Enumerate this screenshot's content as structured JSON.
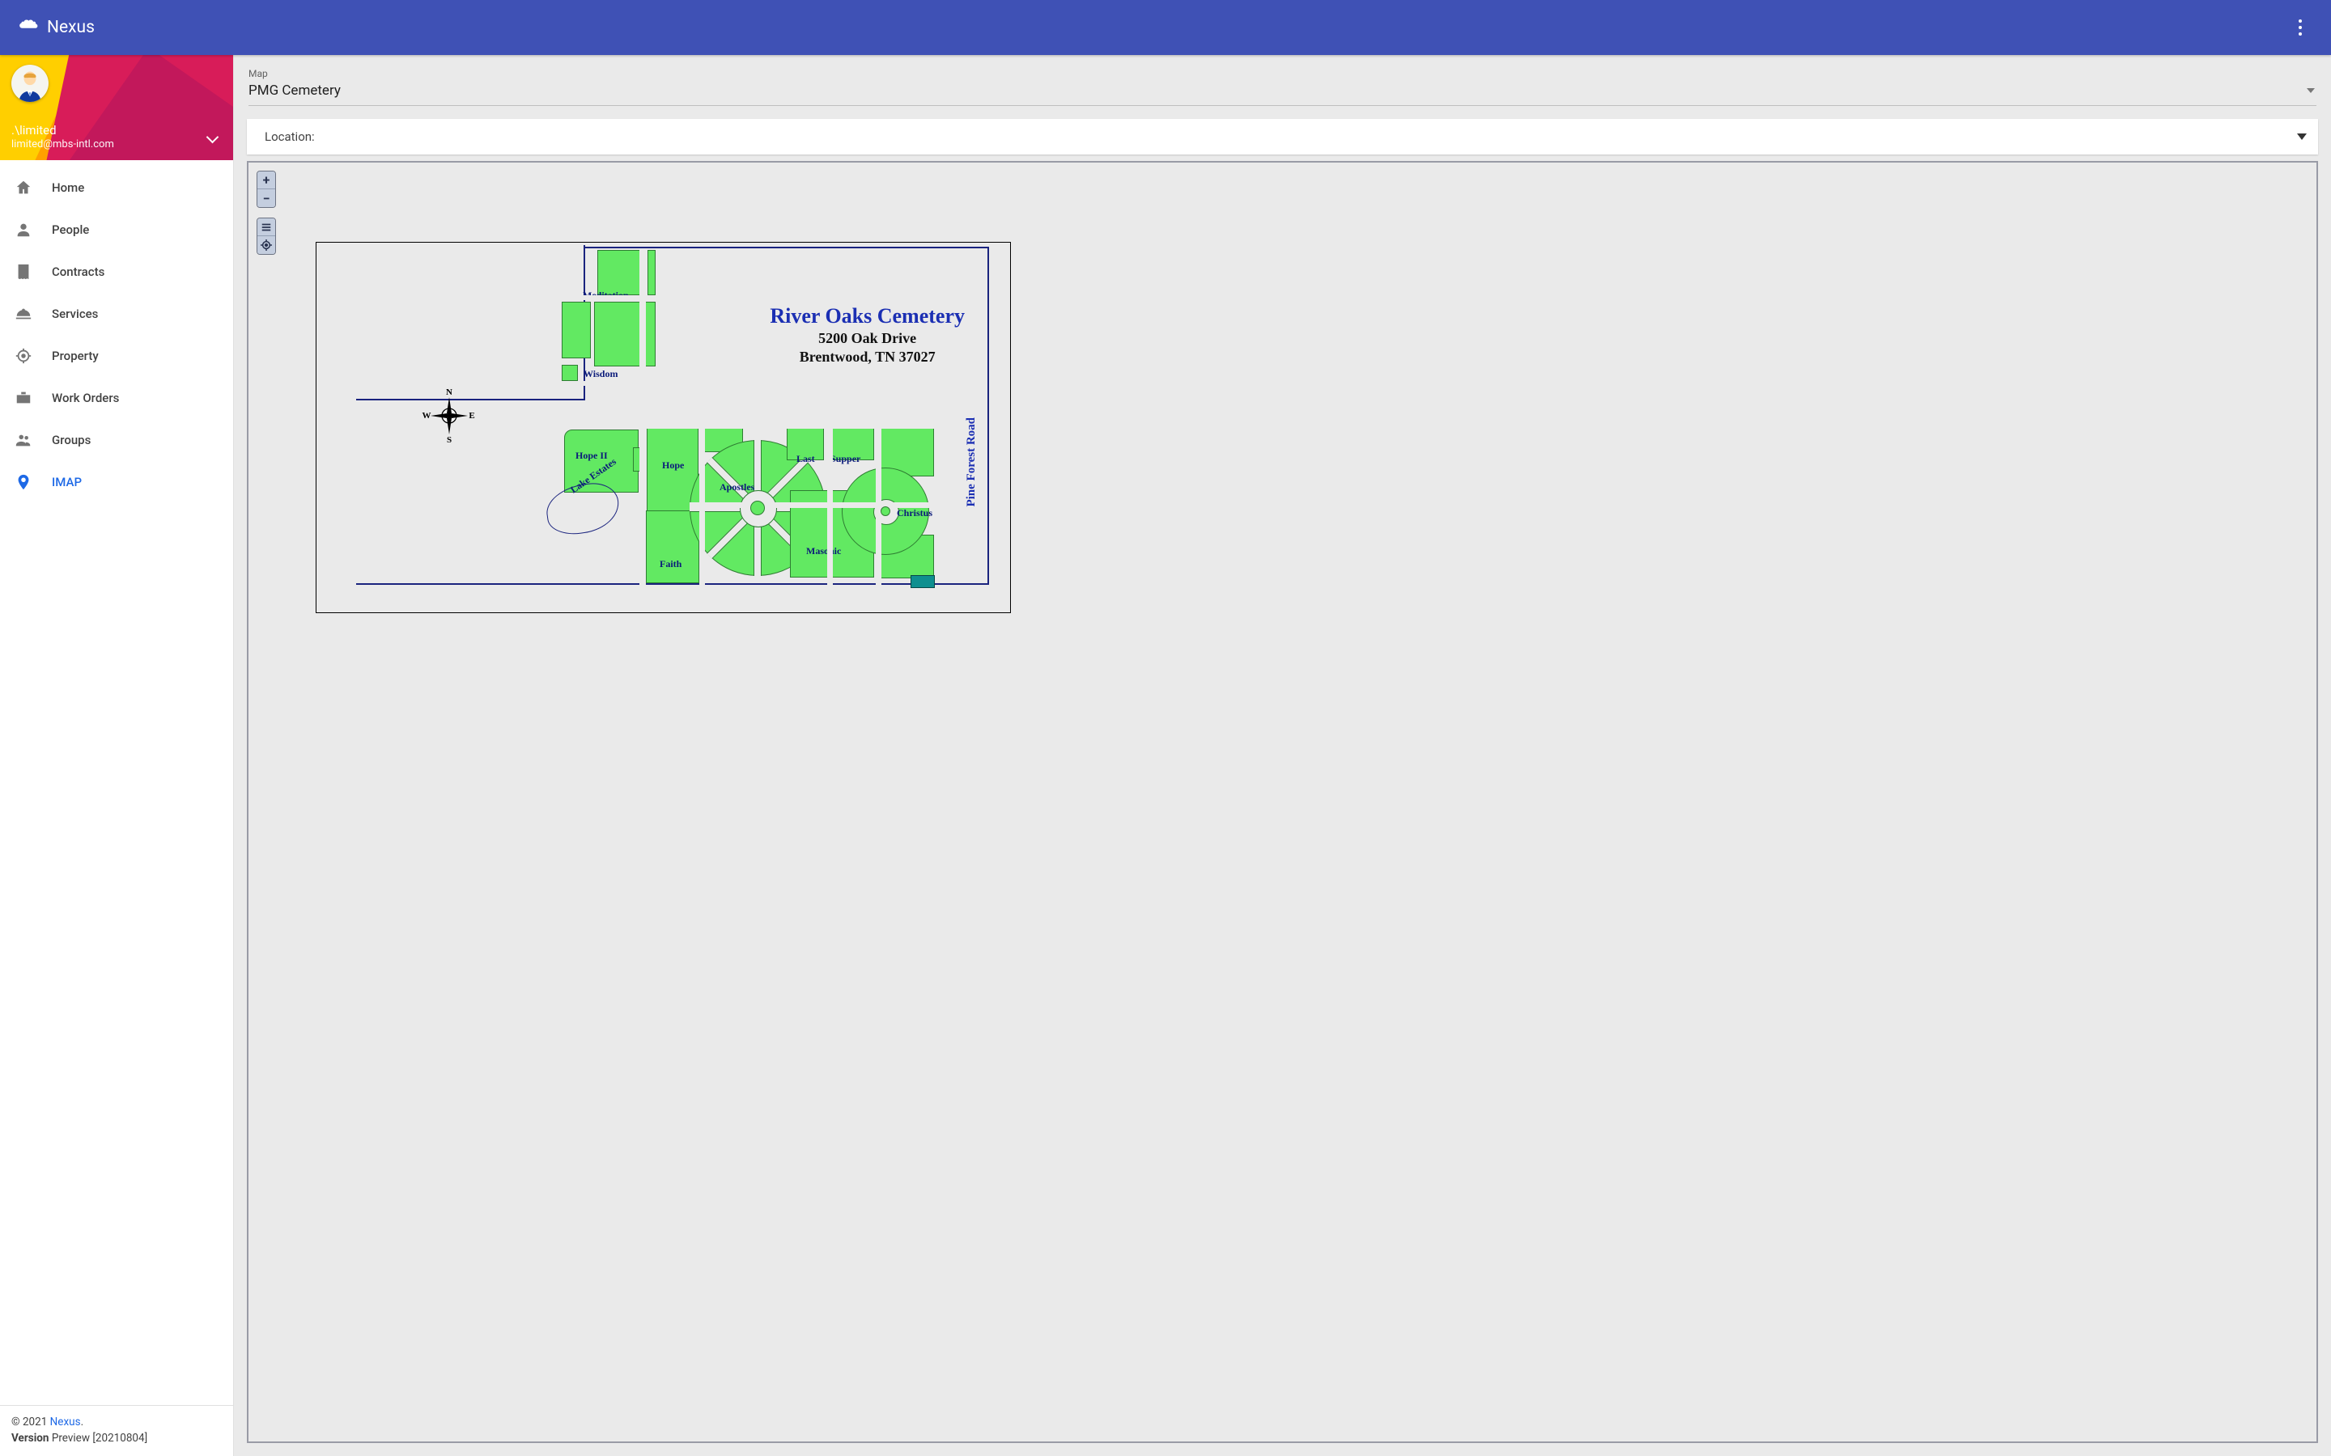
{
  "appbar": {
    "title": "Nexus"
  },
  "user": {
    "name": ".\\limited",
    "email": "limited@mbs-intl.com"
  },
  "sidebar": {
    "items": [
      {
        "label": "Home"
      },
      {
        "label": "People"
      },
      {
        "label": "Contracts"
      },
      {
        "label": "Services"
      },
      {
        "label": "Property"
      },
      {
        "label": "Work Orders"
      },
      {
        "label": "Groups"
      },
      {
        "label": "IMAP"
      }
    ],
    "active_index": 7
  },
  "footer": {
    "copyright_prefix": "© 2021 ",
    "brand": "Nexus",
    "suffix": ".",
    "version_label": "Version",
    "version_value": " Preview [20210804]"
  },
  "map_select": {
    "label": "Map",
    "value": "PMG Cemetery"
  },
  "location_bar": {
    "label": "Location:"
  },
  "cemetery": {
    "title": "River Oaks Cemetery",
    "address1": "5200 Oak Drive",
    "address2": "Brentwood, TN  37027",
    "street": "Pine Forest Road",
    "compass": {
      "n": "N",
      "e": "E",
      "s": "S",
      "w": "W"
    },
    "sections": {
      "meditation": "Meditation",
      "wisdom": "Wisdom",
      "hope2": "Hope II",
      "hope": "Hope",
      "lake": "Lake Estates",
      "apostles": "Apostles",
      "last": "Last",
      "supper": "Supper",
      "masonic": "Masonic",
      "christus": "Christus",
      "faith": "Faith"
    }
  }
}
